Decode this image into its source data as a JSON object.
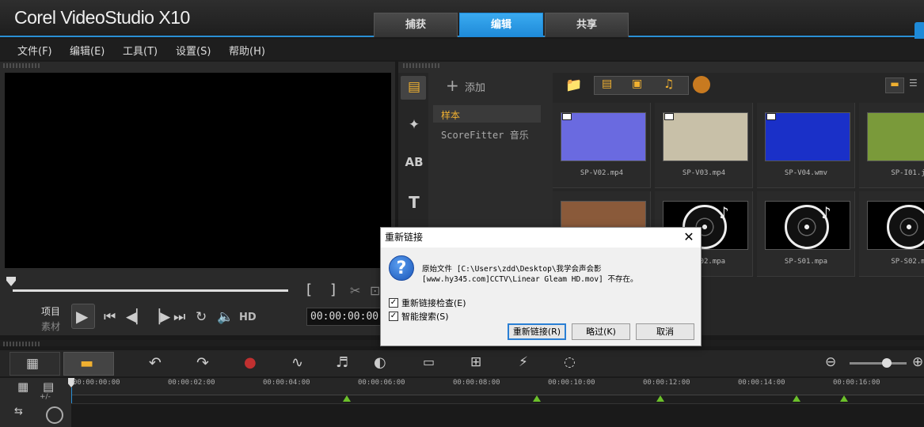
{
  "app": {
    "title": "Corel VideoStudio X10",
    "accent": "#1e8ad8"
  },
  "workspace_tabs": [
    {
      "label": "捕获"
    },
    {
      "label": "编辑",
      "active": true
    },
    {
      "label": "共享"
    }
  ],
  "menu": [
    {
      "label": "文件(F)"
    },
    {
      "label": "编辑(E)"
    },
    {
      "label": "工具(T)"
    },
    {
      "label": "设置(S)"
    },
    {
      "label": "帮助(H)"
    }
  ],
  "player": {
    "mode_project": "项目",
    "mode_clip": "素材",
    "hd_label": "HD",
    "timecode": "00:00:00:00",
    "trim_start": "[",
    "trim_end": "]"
  },
  "library": {
    "add_label": "添加",
    "tree": [
      {
        "label": "样本",
        "selected": true
      },
      {
        "label": "ScoreFitter 音乐"
      }
    ],
    "thumbs": [
      {
        "label": "SP-V02.mp4",
        "kind": "video",
        "color": "#6a6ae0"
      },
      {
        "label": "SP-V03.mp4",
        "kind": "video",
        "color": "#c8c0a8"
      },
      {
        "label": "SP-V04.wmv",
        "kind": "video",
        "color": "#1a30c8"
      },
      {
        "label": "SP-I01.j",
        "kind": "image",
        "color": "#7a9a3a"
      },
      {
        "label": "",
        "kind": "image",
        "color": "#8a5a3a"
      },
      {
        "label": "SP-M02.mpa",
        "kind": "audio",
        "color": "#000"
      },
      {
        "label": "SP-S01.mpa",
        "kind": "audio",
        "color": "#000"
      },
      {
        "label": "SP-S02.m",
        "kind": "audio",
        "color": "#000"
      }
    ]
  },
  "timeline": {
    "ticks": [
      "00:00:00:00",
      "00:00:02:00",
      "00:00:04:00",
      "00:00:06:00",
      "00:00:08:00",
      "00:00:10:00",
      "00:00:12:00",
      "00:00:14:00",
      "00:00:16:00"
    ],
    "add_remove_label": "+/-"
  },
  "dialog": {
    "title": "重新链接",
    "close": "✕",
    "message_line1": "原始文件 [C:\\Users\\zdd\\Desktop\\我学会声会影",
    "message_line2": "[www.hy345.com]CCTV\\Linear Gleam HD.mov] 不存在。",
    "check_relink": "重新链接检查(E)",
    "check_smart": "智能搜索(S)",
    "btn_relink": "重新链接(R)",
    "btn_skip": "略过(K)",
    "btn_cancel": "取消"
  }
}
